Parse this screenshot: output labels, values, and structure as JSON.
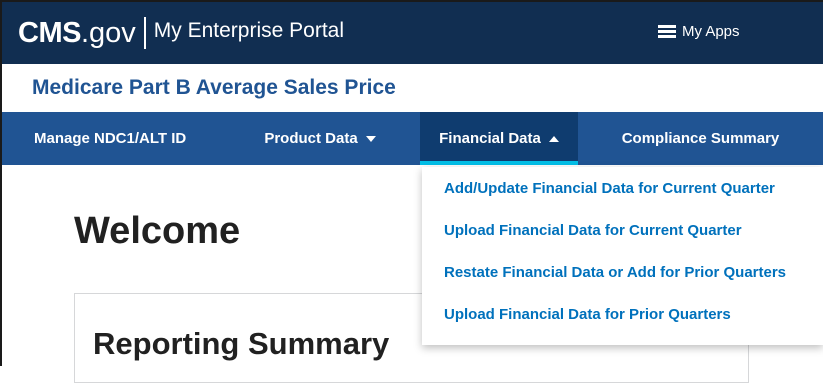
{
  "portal": {
    "logo_cms": "CMS",
    "logo_gov": ".gov",
    "portal_name": "My Enterprise Portal",
    "my_apps_label": "My Apps",
    "my_apps_icon": "list-icon"
  },
  "app": {
    "title": "Medicare Part B Average Sales Price"
  },
  "nav": {
    "items": [
      {
        "label": "Manage NDC1/ALT ID"
      },
      {
        "label": "Product Data",
        "icon": "chevron-down-icon"
      },
      {
        "label": "Financial Data",
        "icon": "chevron-up-icon",
        "active": true
      },
      {
        "label": "Compliance Summary"
      }
    ]
  },
  "dropdown": {
    "items": [
      {
        "label": "Add/Update Financial Data for Current Quarter"
      },
      {
        "label": "Upload Financial Data for Current Quarter"
      },
      {
        "label": "Restate Financial Data or Add for Prior Quarters"
      },
      {
        "label": "Upload Financial Data for Prior Quarters"
      }
    ]
  },
  "main": {
    "heading": "Welcome",
    "card_title": "Reporting Summary"
  },
  "colors": {
    "topbar": "#112e51",
    "nav": "#205493",
    "nav_active": "#0f3c6f",
    "active_underline": "#02bfe7",
    "link": "#0071bc",
    "title": "#205493"
  }
}
